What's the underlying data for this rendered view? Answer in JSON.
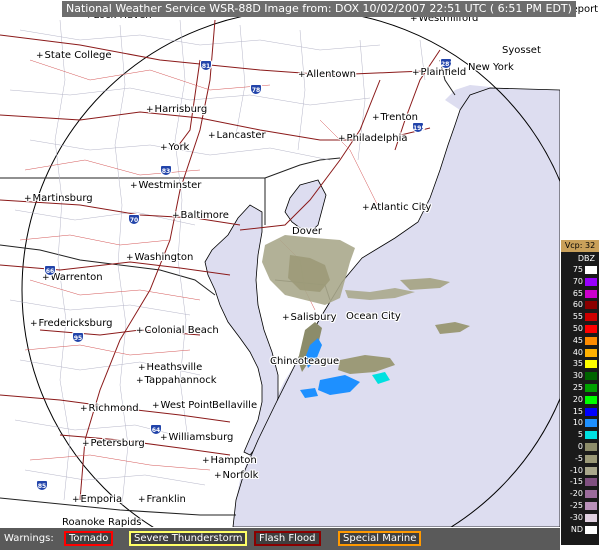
{
  "header": {
    "title": "National Weather Service WSR-88D Image from: DOX 10/02/2007 22:51 UTC ( 6:51 PM EDT)"
  },
  "map": {
    "background_color": "#ffffff",
    "coverage_color": "#ddddf0",
    "cities": [
      {
        "name": "Lock Haven"
      },
      {
        "name": "Westmilford"
      },
      {
        "name": "Bridgeport"
      },
      {
        "name": "State College"
      },
      {
        "name": "Syosset"
      },
      {
        "name": "Allentown"
      },
      {
        "name": "Plainfield"
      },
      {
        "name": "New York"
      },
      {
        "name": "Harrisburg"
      },
      {
        "name": "Trenton"
      },
      {
        "name": "Lancaster"
      },
      {
        "name": "Philadelphia"
      },
      {
        "name": "York"
      },
      {
        "name": "Westminster"
      },
      {
        "name": "Martinsburg"
      },
      {
        "name": "Baltimore"
      },
      {
        "name": "Atlantic City"
      },
      {
        "name": "Dover"
      },
      {
        "name": "Washington"
      },
      {
        "name": "Warrenton"
      },
      {
        "name": "Salisbury"
      },
      {
        "name": "Ocean City"
      },
      {
        "name": "Fredericksburg"
      },
      {
        "name": "Colonial Beach"
      },
      {
        "name": "Chincoteague"
      },
      {
        "name": "Heathsville"
      },
      {
        "name": "Tappahannock"
      },
      {
        "name": "West Point"
      },
      {
        "name": "Bellaville"
      },
      {
        "name": "Richmond"
      },
      {
        "name": "Williamsburg"
      },
      {
        "name": "Petersburg"
      },
      {
        "name": "Hampton"
      },
      {
        "name": "Norfolk"
      },
      {
        "name": "Emporia"
      },
      {
        "name": "Franklin"
      },
      {
        "name": "Roanoke Rapids"
      }
    ],
    "highways": [
      "81",
      "78",
      "287",
      "83",
      "195",
      "70",
      "66",
      "95",
      "64",
      "85"
    ]
  },
  "legend": {
    "vcp": "Vcp: 32",
    "unit": "DBZ",
    "items": [
      {
        "label": "75",
        "color": "#ffffff"
      },
      {
        "label": "70",
        "color": "#9900ff"
      },
      {
        "label": "65",
        "color": "#cc00cc"
      },
      {
        "label": "60",
        "color": "#8b0000"
      },
      {
        "label": "55",
        "color": "#cc0000"
      },
      {
        "label": "50",
        "color": "#ff0000"
      },
      {
        "label": "45",
        "color": "#ff8c00"
      },
      {
        "label": "40",
        "color": "#ffb000"
      },
      {
        "label": "35",
        "color": "#ffff00"
      },
      {
        "label": "30",
        "color": "#006400"
      },
      {
        "label": "25",
        "color": "#00a000"
      },
      {
        "label": "20",
        "color": "#00ff00"
      },
      {
        "label": "15",
        "color": "#0000ff"
      },
      {
        "label": "10",
        "color": "#1e90ff"
      },
      {
        "label": "5",
        "color": "#00e0e0"
      },
      {
        "label": "0",
        "color": "#8c8c6a"
      },
      {
        "label": "-5",
        "color": "#9c9a78"
      },
      {
        "label": "-10",
        "color": "#aaa88c"
      },
      {
        "label": "-15",
        "color": "#805080"
      },
      {
        "label": "-20",
        "color": "#9c6c9c"
      },
      {
        "label": "-25",
        "color": "#b890b8"
      },
      {
        "label": "-30",
        "color": "#e0d0e0"
      },
      {
        "label": "ND",
        "color": "#ffffff"
      }
    ]
  },
  "warnings": {
    "label": "Warnings:",
    "items": [
      {
        "label": "Tornado",
        "color": "#ff0000"
      },
      {
        "label": "Severe Thunderstorm",
        "color": "#ffff66"
      },
      {
        "label": "Flash Flood",
        "color": "#8b0000"
      },
      {
        "label": "Special Marine",
        "color": "#ff9900"
      }
    ]
  }
}
